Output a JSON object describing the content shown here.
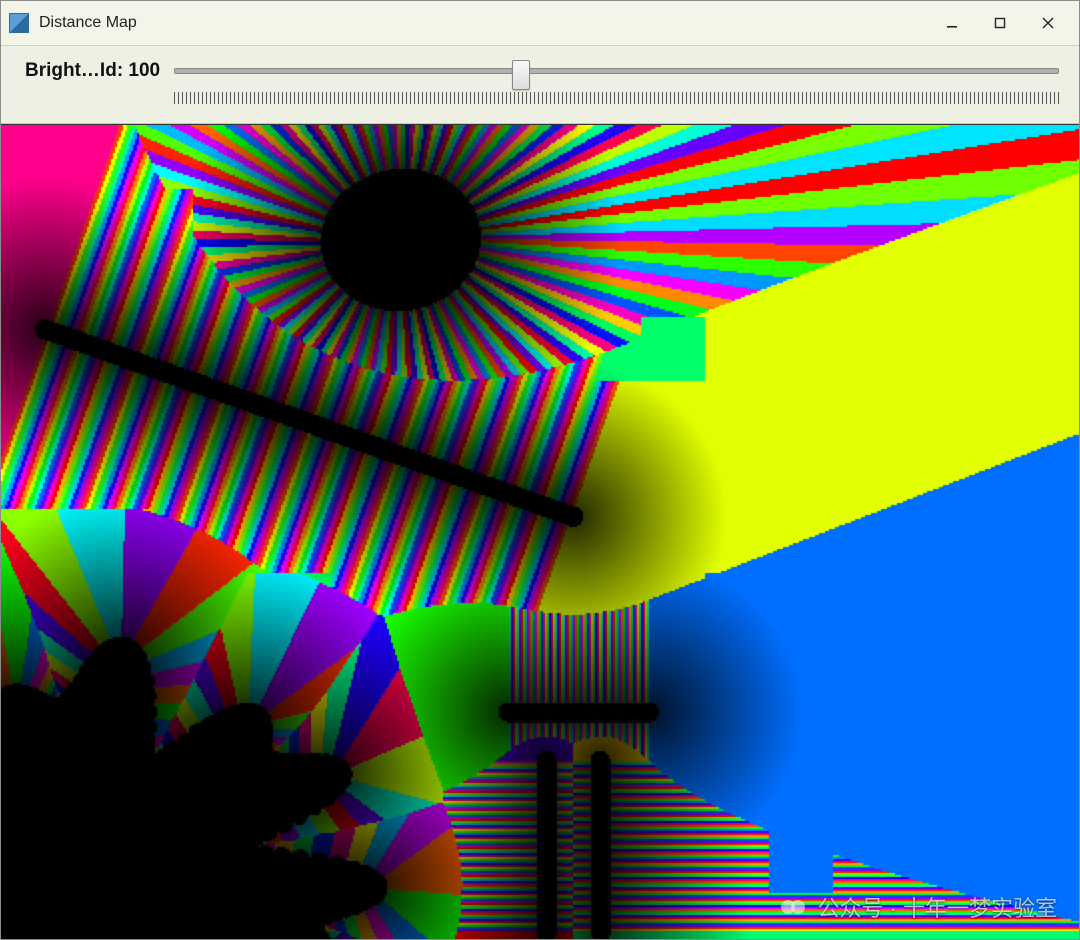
{
  "window": {
    "title": "Distance Map",
    "controls": {
      "minimize_hint": "Minimize",
      "maximize_hint": "Maximize",
      "close_hint": "Close"
    }
  },
  "toolbar": {
    "slider": {
      "label": "Bright…Id: 100",
      "min": 0,
      "max": 255,
      "value": 100,
      "thumb_position_percent": 39.2
    }
  },
  "visualization": {
    "type": "distance_map_labelled_voronoi",
    "description": "Colored nearest-seed / Voronoi-style distance map with black seed regions",
    "seeds": [
      {
        "shape": "ellipse",
        "cx": 0.37,
        "cy": 0.14,
        "rx": 0.065,
        "ry": 0.075,
        "rotation_deg": -8
      },
      {
        "shape": "line",
        "x1": 0.04,
        "y1": 0.25,
        "x2": 0.53,
        "y2": 0.48,
        "thickness": 10
      },
      {
        "shape": "line",
        "x1": 0.47,
        "y1": 0.72,
        "x2": 0.6,
        "y2": 0.72,
        "thickness": 10
      },
      {
        "shape": "line",
        "x1": 0.505,
        "y1": 0.78,
        "x2": 0.505,
        "y2": 0.99,
        "thickness": 12
      },
      {
        "shape": "line",
        "x1": 0.555,
        "y1": 0.78,
        "x2": 0.555,
        "y2": 0.99,
        "thickness": 12
      },
      {
        "shape": "blob",
        "cx": 0.08,
        "cy": 0.92,
        "r": 0.22,
        "roughness": 0.35
      }
    ],
    "palette_hue_cycle": true
  },
  "watermark": {
    "text": "公众号 · 十年一梦实验室"
  }
}
